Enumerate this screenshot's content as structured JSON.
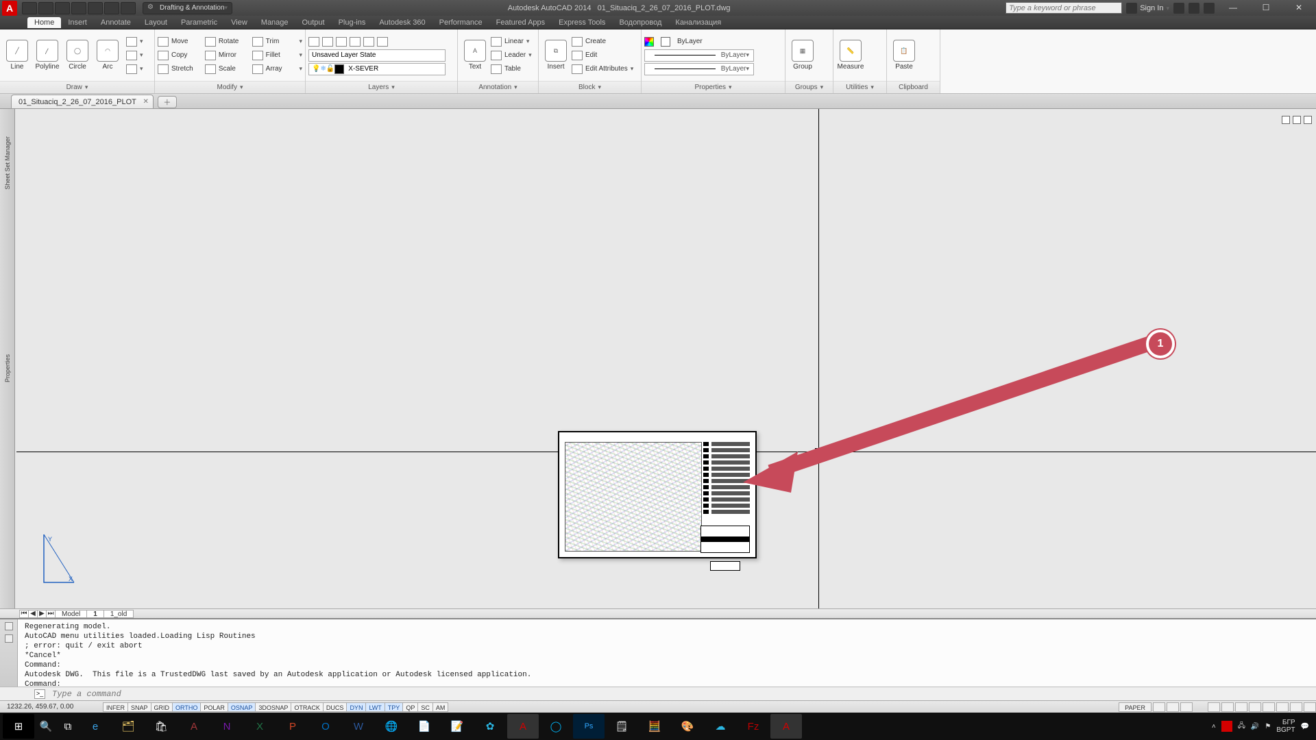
{
  "title": {
    "app": "Autodesk AutoCAD 2014",
    "file": "01_Situaciq_2_26_07_2016_PLOT.dwg"
  },
  "workspace": "Drafting & Annotation",
  "search_placeholder": "Type a keyword or phrase",
  "signin": "Sign In",
  "menus": [
    "Home",
    "Insert",
    "Annotate",
    "Layout",
    "Parametric",
    "View",
    "Manage",
    "Output",
    "Plug-ins",
    "Autodesk 360",
    "Performance",
    "Featured Apps",
    "Express Tools",
    "Водопровод",
    "Канализация"
  ],
  "active_menu": "Home",
  "ribbon": {
    "draw": {
      "title": "Draw",
      "btns": [
        "Line",
        "Polyline",
        "Circle",
        "Arc"
      ]
    },
    "modify": {
      "title": "Modify",
      "rows": [
        [
          "Move",
          "Rotate",
          "Trim"
        ],
        [
          "Copy",
          "Mirror",
          "Fillet"
        ],
        [
          "Stretch",
          "Scale",
          "Array"
        ]
      ]
    },
    "layers": {
      "title": "Layers",
      "state": "Unsaved Layer State",
      "current": "X-SEVER"
    },
    "annotation": {
      "title": "Annotation",
      "btns": [
        "Text"
      ],
      "rows": [
        "Linear",
        "Leader",
        "Table"
      ]
    },
    "block": {
      "title": "Block",
      "btns": [
        "Insert"
      ],
      "rows": [
        "Create",
        "Edit",
        "Edit Attributes"
      ]
    },
    "properties": {
      "title": "Properties",
      "bylayer": "ByLayer"
    },
    "groups": {
      "title": "Groups",
      "btn": "Group"
    },
    "utilities": {
      "title": "Utilities",
      "btn": "Measure"
    },
    "clipboard": {
      "title": "Clipboard",
      "btn": "Paste"
    }
  },
  "file_tab": "01_Situaciq_2_26_07_2016_PLOT",
  "sidebar_labels": {
    "top": "Sheet Set Manager",
    "bottom": "Properties"
  },
  "model_tabs": [
    "Model",
    "1",
    "1_old"
  ],
  "active_model_tab": "1",
  "command_log": "Regenerating model.\nAutoCAD menu utilities loaded.Loading Lisp Routines\n; error: quit / exit abort\n*Cancel*\nCommand:\nAutodesk DWG.  This file is a TrustedDWG last saved by an Autodesk application or Autodesk licensed application.\nCommand:",
  "command_placeholder": "Type a command",
  "coords": "1232.26, 459.67, 0.00",
  "toggles": [
    "INFER",
    "SNAP",
    "GRID",
    "ORTHO",
    "POLAR",
    "OSNAP",
    "3DOSNAP",
    "OTRACK",
    "DUCS",
    "DYN",
    "LWT",
    "TPY",
    "QP",
    "SC",
    "AM"
  ],
  "toggles_on": [
    "ORTHO",
    "OSNAP",
    "DYN",
    "LWT",
    "TPY"
  ],
  "status_right": {
    "paper": "PAPER"
  },
  "tray": {
    "lang": "БГР",
    "kbd": "BGPT"
  },
  "annotation_badge": "1"
}
